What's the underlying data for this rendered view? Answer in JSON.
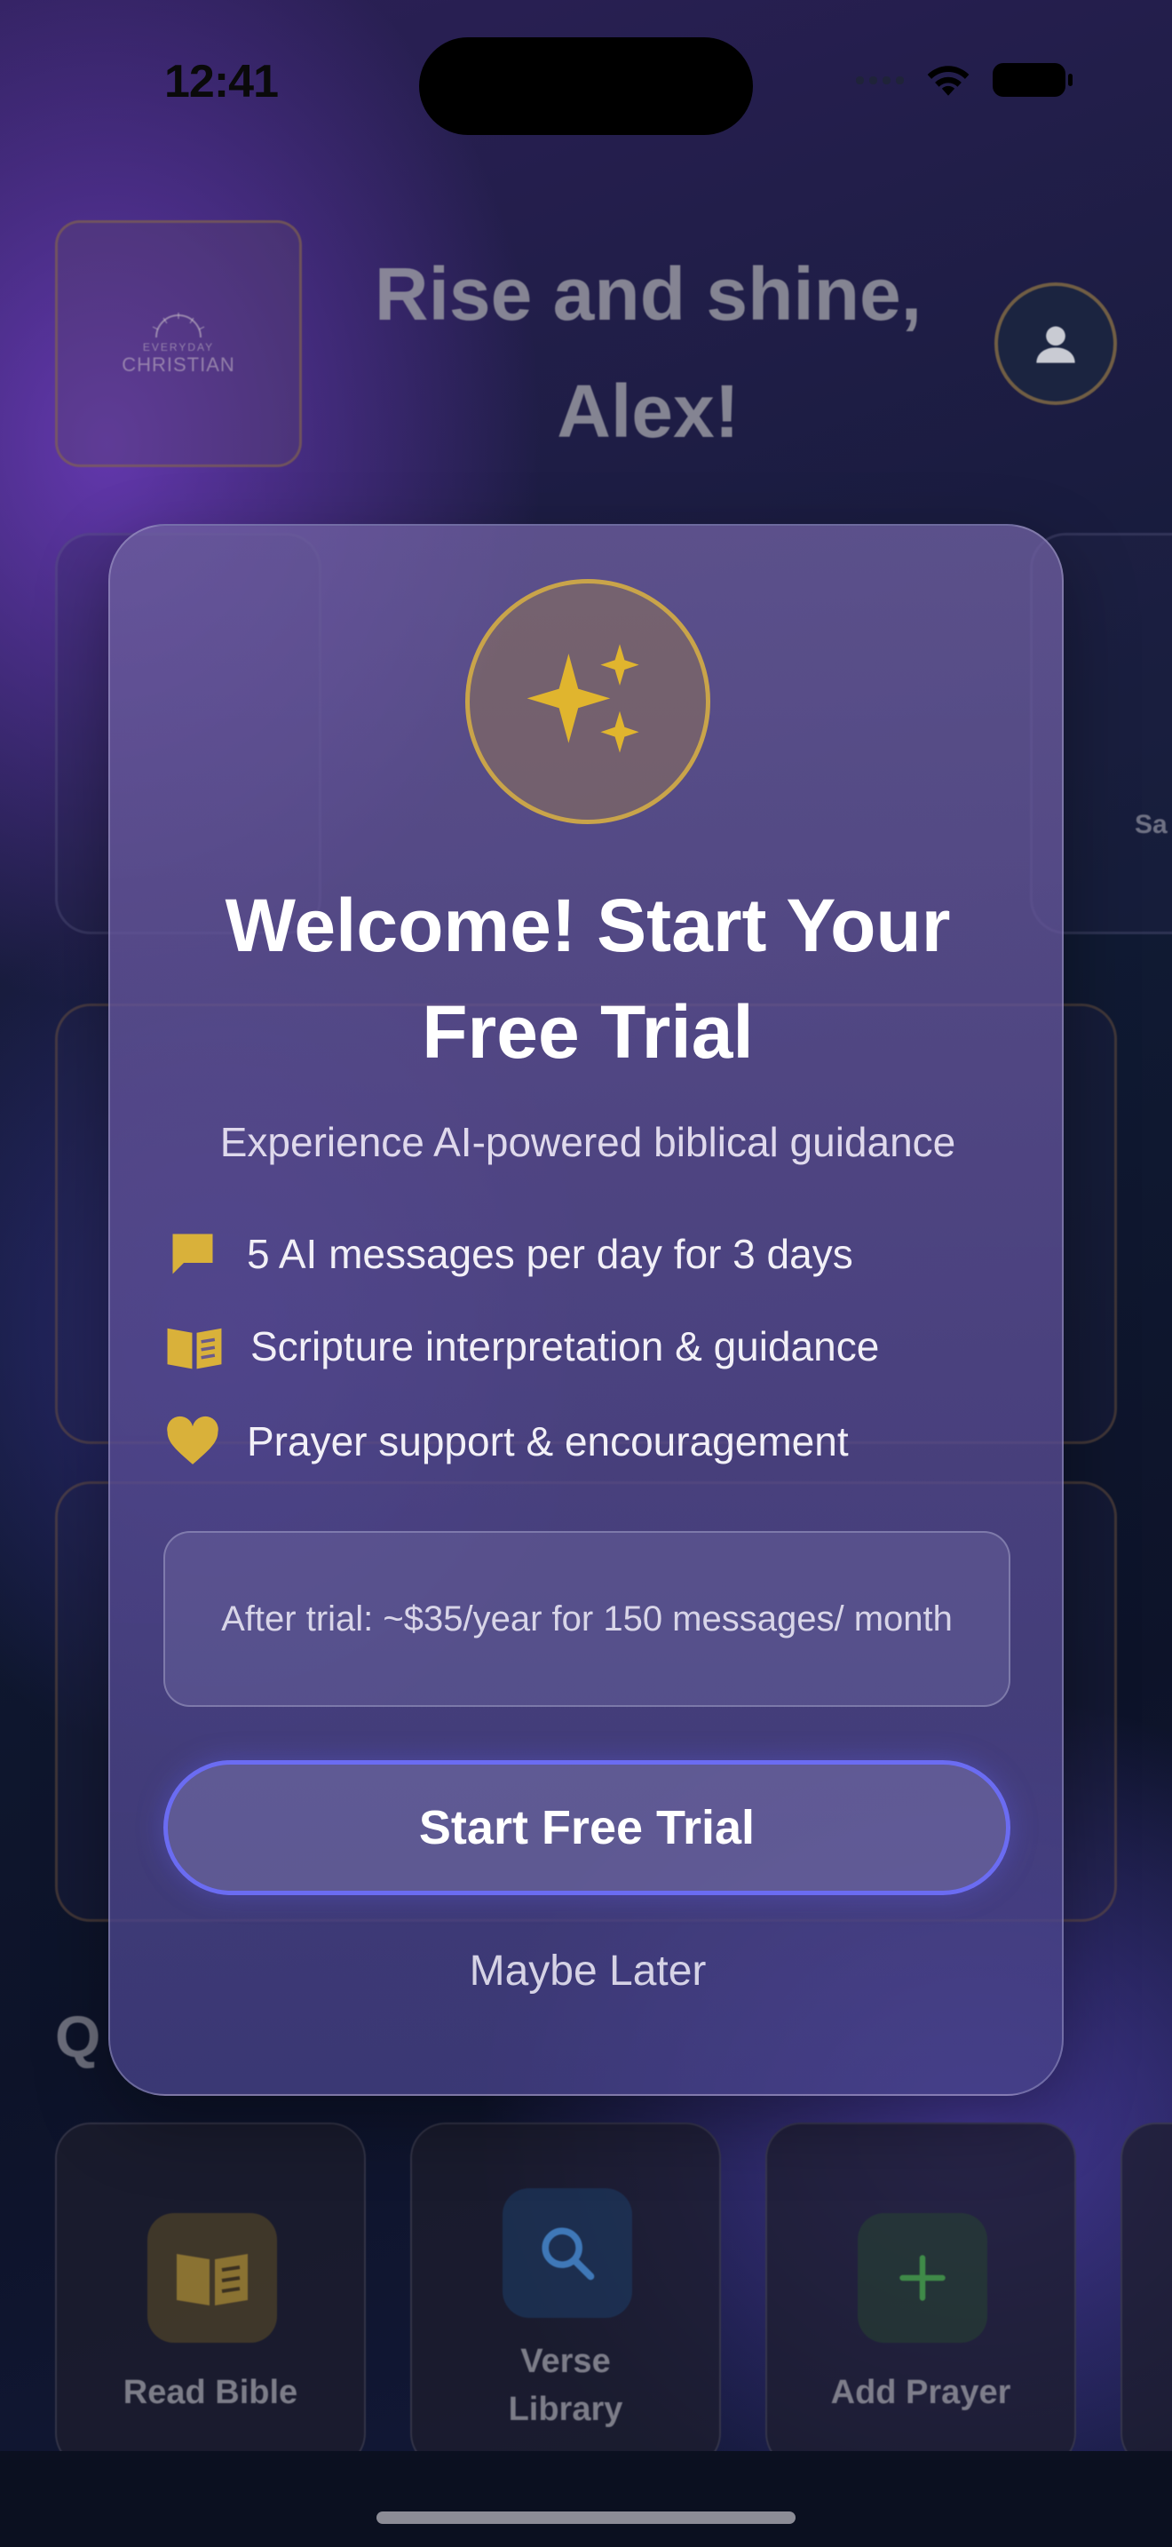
{
  "status_bar": {
    "time": "12:41"
  },
  "header": {
    "logo": {
      "top": "EVERYDAY",
      "bottom": "CHRISTIAN"
    },
    "greeting": "Rise and shine, Alex!"
  },
  "peek_text": "Sa",
  "section_heading": "Q",
  "quick_actions": [
    {
      "label": "Read Bible",
      "icon": "open-book-icon"
    },
    {
      "label": "Verse Library",
      "icon": "search-icon"
    },
    {
      "label": "Add Prayer",
      "icon": "plus-icon"
    }
  ],
  "modal": {
    "icon": "sparkles-icon",
    "title": "Welcome! Start Your Free Trial",
    "subtitle": "Experience AI-powered biblical guidance",
    "features": [
      {
        "icon": "chat-bubble-icon",
        "text": "5 AI messages per day for 3 days"
      },
      {
        "icon": "book-icon",
        "text": "Scripture interpretation & guidance"
      },
      {
        "icon": "heart-icon",
        "text": "Prayer support & encouragement"
      }
    ],
    "trial_note": "After trial: ~$35/year for 150 messages/ month",
    "cta_label": "Start Free Trial",
    "secondary_label": "Maybe Later"
  },
  "colors": {
    "accent_gold": "#d9b13a",
    "cta_border": "#6b6cf2"
  }
}
